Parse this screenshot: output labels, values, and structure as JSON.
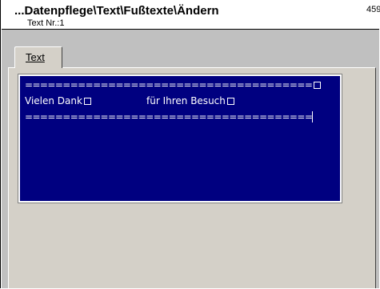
{
  "window": {
    "title": "...Datenpflege\\Text\\Fußtexte\\Ändern",
    "subtitle": "Text Nr.:1",
    "corner_number": "459"
  },
  "tabs": [
    {
      "label": "Text",
      "active": true
    }
  ],
  "editor": {
    "line1": "======================================",
    "line2_left": "Vielen Dank",
    "line2_right": "für Ihren Besuch",
    "line3": "======================================",
    "background_color": "#000080",
    "text_color": "#ffffff"
  }
}
